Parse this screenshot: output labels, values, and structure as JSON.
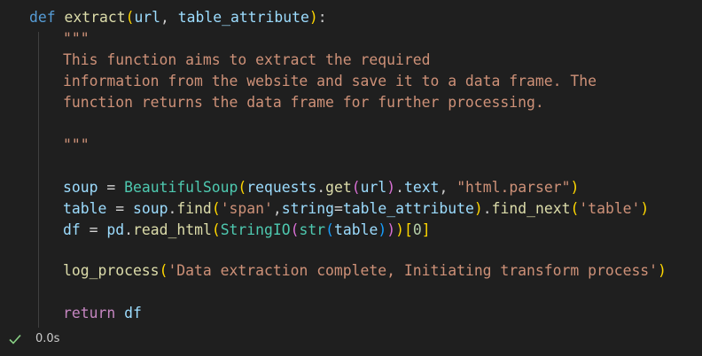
{
  "code": {
    "keyword_def": "def",
    "keyword_return": "return",
    "function_name": "extract",
    "param_url": "url",
    "param_table_attribute": "table_attribute",
    "docstring_open": "\"\"\"",
    "docstring_line1": "This function aims to extract the required",
    "docstring_line2": "information from the website and save it to a data frame. The",
    "docstring_line3": "function returns the data frame for further processing.",
    "docstring_close": "\"\"\"",
    "var_soup": "soup",
    "var_table": "table",
    "var_df": "df",
    "cls_beautifulsoup": "BeautifulSoup",
    "mod_requests": "requests",
    "fn_get": "get",
    "attr_text": "text",
    "str_html_parser": "\"html.parser\"",
    "fn_find": "find",
    "str_span": "'span'",
    "kwarg_string": "string",
    "fn_find_next": "find_next",
    "str_table": "'table'",
    "mod_pd": "pd",
    "fn_read_html": "read_html",
    "cls_stringio": "StringIO",
    "cls_str": "str",
    "num_zero": "0",
    "fn_log_process": "log_process",
    "str_log_message": "'Data extraction complete, Initiating transform process'"
  },
  "status": {
    "exec_time": "0.0s",
    "icon": "check-icon",
    "success_color": "#89d185"
  }
}
